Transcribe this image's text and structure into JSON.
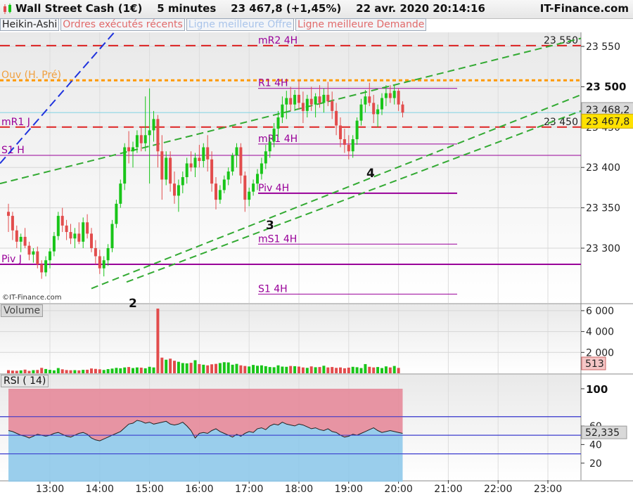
{
  "header": {
    "instrument": "Wall Street Cash (1€)",
    "interval": "5 minutes",
    "last": "23 467,8",
    "change": "(+1,45%)",
    "datetime": "22 avr. 2020 20:14:16",
    "site": "IT-Finance.com"
  },
  "tabs": [
    "Heikin-Ashi",
    "Ordres exécutés récents",
    "Ligne meilleure Offre",
    "Ligne meilleure Demande"
  ],
  "watermark": "©IT-Finance.com",
  "colors": {
    "up": "#19c519",
    "down": "#e24c4c",
    "rsi_upper_fill": "#e58a9a",
    "rsi_lower_fill": "#8fc9ea",
    "level": "#990099",
    "resistance": "#dd2222",
    "open_line": "#ff9900",
    "trend": "#33aa33",
    "trend_blue": "#1f33dd"
  },
  "chart_data": [
    {
      "type": "candlestick",
      "title": "Wall Street Cash (1€) — 5 minutes",
      "x_ticks": [
        "13:00",
        "14:00",
        "15:00",
        "16:00",
        "17:00",
        "18:00",
        "19:00",
        "20:00",
        "21:00",
        "22:00",
        "23:00"
      ],
      "y_ticks": [
        "23 300",
        "23 350",
        "23 400",
        "23 450",
        "23 500",
        "23 550"
      ],
      "ylim": [
        23260,
        23570
      ],
      "price_labels": {
        "last_ask": "23 468,2",
        "last_bid": "23 467,8"
      },
      "horizontal_levels": [
        {
          "name": "mR2 4H",
          "value": 23551,
          "text": "23 550",
          "style": "dash-red"
        },
        {
          "name": "Ouv (H. Pré)",
          "value": 23508,
          "style": "dash-orange"
        },
        {
          "name": "23 500",
          "value": 23500,
          "style": "axis-bold"
        },
        {
          "name": "R1 4H",
          "value": 23498
        },
        {
          "name": "mR1 J",
          "value": 23450,
          "text": "23 450",
          "style": "dash-red"
        },
        {
          "name": "mR1 4H",
          "value": 23429
        },
        {
          "name": "S1 H",
          "value": 23415
        },
        {
          "name": "Piv 4H",
          "value": 23368
        },
        {
          "name": "mS1 4H",
          "value": 23305
        },
        {
          "name": "Piv J",
          "value": 23280
        },
        {
          "name": "S1 4H",
          "value": 23243
        }
      ],
      "annotations": [
        "2",
        "3",
        "4"
      ],
      "candles": [
        {
          "t": "12:10",
          "o": 23345,
          "h": 23355,
          "l": 23320,
          "c": 23340
        },
        {
          "t": "12:15",
          "o": 23340,
          "h": 23345,
          "l": 23310,
          "c": 23322
        },
        {
          "t": "12:20",
          "o": 23322,
          "h": 23328,
          "l": 23300,
          "c": 23308
        },
        {
          "t": "12:25",
          "o": 23308,
          "h": 23318,
          "l": 23295,
          "c": 23314
        },
        {
          "t": "12:30",
          "o": 23314,
          "h": 23325,
          "l": 23300,
          "c": 23303
        },
        {
          "t": "12:35",
          "o": 23303,
          "h": 23308,
          "l": 23285,
          "c": 23292
        },
        {
          "t": "12:40",
          "o": 23292,
          "h": 23300,
          "l": 23282,
          "c": 23296
        },
        {
          "t": "12:45",
          "o": 23296,
          "h": 23302,
          "l": 23275,
          "c": 23280
        },
        {
          "t": "12:50",
          "o": 23280,
          "h": 23285,
          "l": 23262,
          "c": 23270
        },
        {
          "t": "12:55",
          "o": 23270,
          "h": 23290,
          "l": 23265,
          "c": 23285
        },
        {
          "t": "13:00",
          "o": 23285,
          "h": 23300,
          "l": 23275,
          "c": 23296
        },
        {
          "t": "13:05",
          "o": 23296,
          "h": 23320,
          "l": 23290,
          "c": 23315
        },
        {
          "t": "13:10",
          "o": 23315,
          "h": 23345,
          "l": 23310,
          "c": 23340
        },
        {
          "t": "13:15",
          "o": 23340,
          "h": 23350,
          "l": 23320,
          "c": 23328
        },
        {
          "t": "13:20",
          "o": 23328,
          "h": 23335,
          "l": 23310,
          "c": 23320
        },
        {
          "t": "13:25",
          "o": 23320,
          "h": 23330,
          "l": 23305,
          "c": 23312
        },
        {
          "t": "13:30",
          "o": 23312,
          "h": 23325,
          "l": 23300,
          "c": 23318
        },
        {
          "t": "13:35",
          "o": 23318,
          "h": 23332,
          "l": 23305,
          "c": 23308
        },
        {
          "t": "13:40",
          "o": 23308,
          "h": 23338,
          "l": 23300,
          "c": 23332
        },
        {
          "t": "13:45",
          "o": 23332,
          "h": 23342,
          "l": 23312,
          "c": 23318
        },
        {
          "t": "13:50",
          "o": 23318,
          "h": 23325,
          "l": 23295,
          "c": 23300
        },
        {
          "t": "13:55",
          "o": 23300,
          "h": 23310,
          "l": 23280,
          "c": 23290
        },
        {
          "t": "14:00",
          "o": 23290,
          "h": 23298,
          "l": 23268,
          "c": 23275
        },
        {
          "t": "14:05",
          "o": 23275,
          "h": 23290,
          "l": 23265,
          "c": 23285
        },
        {
          "t": "14:10",
          "o": 23285,
          "h": 23305,
          "l": 23278,
          "c": 23300
        },
        {
          "t": "14:15",
          "o": 23300,
          "h": 23335,
          "l": 23295,
          "c": 23330
        },
        {
          "t": "14:20",
          "o": 23330,
          "h": 23360,
          "l": 23325,
          "c": 23355
        },
        {
          "t": "14:25",
          "o": 23355,
          "h": 23385,
          "l": 23350,
          "c": 23380
        },
        {
          "t": "14:30",
          "o": 23380,
          "h": 23430,
          "l": 23372,
          "c": 23425
        },
        {
          "t": "14:35",
          "o": 23425,
          "h": 23445,
          "l": 23405,
          "c": 23420
        },
        {
          "t": "14:40",
          "o": 23420,
          "h": 23432,
          "l": 23400,
          "c": 23425
        },
        {
          "t": "14:45",
          "o": 23425,
          "h": 23446,
          "l": 23418,
          "c": 23440
        },
        {
          "t": "14:50",
          "o": 23440,
          "h": 23450,
          "l": 23420,
          "c": 23430
        },
        {
          "t": "14:55",
          "o": 23430,
          "h": 23488,
          "l": 23420,
          "c": 23440
        },
        {
          "t": "15:00",
          "o": 23440,
          "h": 23498,
          "l": 23380,
          "c": 23446
        },
        {
          "t": "15:05",
          "o": 23446,
          "h": 23470,
          "l": 23432,
          "c": 23460
        },
        {
          "t": "15:10",
          "o": 23460,
          "h": 23465,
          "l": 23400,
          "c": 23420
        },
        {
          "t": "15:15",
          "o": 23420,
          "h": 23440,
          "l": 23360,
          "c": 23385
        },
        {
          "t": "15:20",
          "o": 23385,
          "h": 23420,
          "l": 23378,
          "c": 23412
        },
        {
          "t": "15:25",
          "o": 23412,
          "h": 23420,
          "l": 23370,
          "c": 23380
        },
        {
          "t": "15:30",
          "o": 23380,
          "h": 23395,
          "l": 23355,
          "c": 23365
        },
        {
          "t": "15:35",
          "o": 23365,
          "h": 23385,
          "l": 23345,
          "c": 23378
        },
        {
          "t": "15:40",
          "o": 23378,
          "h": 23395,
          "l": 23368,
          "c": 23388
        },
        {
          "t": "15:45",
          "o": 23388,
          "h": 23412,
          "l": 23380,
          "c": 23405
        },
        {
          "t": "15:50",
          "o": 23405,
          "h": 23420,
          "l": 23395,
          "c": 23400
        },
        {
          "t": "15:55",
          "o": 23400,
          "h": 23418,
          "l": 23388,
          "c": 23412
        },
        {
          "t": "16:00",
          "o": 23412,
          "h": 23428,
          "l": 23400,
          "c": 23408
        },
        {
          "t": "16:05",
          "o": 23408,
          "h": 23430,
          "l": 23400,
          "c": 23425
        },
        {
          "t": "16:10",
          "o": 23425,
          "h": 23440,
          "l": 23395,
          "c": 23410
        },
        {
          "t": "16:15",
          "o": 23410,
          "h": 23420,
          "l": 23370,
          "c": 23380
        },
        {
          "t": "16:20",
          "o": 23380,
          "h": 23388,
          "l": 23348,
          "c": 23360
        },
        {
          "t": "16:25",
          "o": 23360,
          "h": 23378,
          "l": 23355,
          "c": 23372
        },
        {
          "t": "16:30",
          "o": 23372,
          "h": 23390,
          "l": 23368,
          "c": 23385
        },
        {
          "t": "16:35",
          "o": 23385,
          "h": 23400,
          "l": 23378,
          "c": 23395
        },
        {
          "t": "16:40",
          "o": 23395,
          "h": 23418,
          "l": 23390,
          "c": 23415
        },
        {
          "t": "16:45",
          "o": 23415,
          "h": 23430,
          "l": 23400,
          "c": 23425
        },
        {
          "t": "16:50",
          "o": 23425,
          "h": 23430,
          "l": 23380,
          "c": 23390
        },
        {
          "t": "16:55",
          "o": 23390,
          "h": 23395,
          "l": 23345,
          "c": 23360
        },
        {
          "t": "17:00",
          "o": 23360,
          "h": 23375,
          "l": 23352,
          "c": 23370
        },
        {
          "t": "17:05",
          "o": 23370,
          "h": 23385,
          "l": 23365,
          "c": 23380
        },
        {
          "t": "17:10",
          "o": 23380,
          "h": 23398,
          "l": 23372,
          "c": 23392
        },
        {
          "t": "17:15",
          "o": 23392,
          "h": 23412,
          "l": 23385,
          "c": 23405
        },
        {
          "t": "17:20",
          "o": 23405,
          "h": 23428,
          "l": 23398,
          "c": 23420
        },
        {
          "t": "17:25",
          "o": 23420,
          "h": 23438,
          "l": 23412,
          "c": 23432
        },
        {
          "t": "17:30",
          "o": 23432,
          "h": 23455,
          "l": 23425,
          "c": 23448
        },
        {
          "t": "17:35",
          "o": 23448,
          "h": 23470,
          "l": 23438,
          "c": 23462
        },
        {
          "t": "17:40",
          "o": 23462,
          "h": 23488,
          "l": 23455,
          "c": 23478
        },
        {
          "t": "17:45",
          "o": 23478,
          "h": 23495,
          "l": 23460,
          "c": 23486
        },
        {
          "t": "17:50",
          "o": 23486,
          "h": 23500,
          "l": 23470,
          "c": 23478
        },
        {
          "t": "17:55",
          "o": 23478,
          "h": 23496,
          "l": 23470,
          "c": 23490
        },
        {
          "t": "18:00",
          "o": 23490,
          "h": 23508,
          "l": 23472,
          "c": 23480
        },
        {
          "t": "18:05",
          "o": 23480,
          "h": 23494,
          "l": 23455,
          "c": 23470
        },
        {
          "t": "18:10",
          "o": 23470,
          "h": 23490,
          "l": 23462,
          "c": 23485
        },
        {
          "t": "18:15",
          "o": 23485,
          "h": 23500,
          "l": 23470,
          "c": 23478
        },
        {
          "t": "18:20",
          "o": 23478,
          "h": 23492,
          "l": 23462,
          "c": 23488
        },
        {
          "t": "18:25",
          "o": 23488,
          "h": 23502,
          "l": 23474,
          "c": 23480
        },
        {
          "t": "18:30",
          "o": 23480,
          "h": 23498,
          "l": 23468,
          "c": 23490
        },
        {
          "t": "18:35",
          "o": 23490,
          "h": 23506,
          "l": 23476,
          "c": 23482
        },
        {
          "t": "18:40",
          "o": 23482,
          "h": 23494,
          "l": 23460,
          "c": 23470
        },
        {
          "t": "18:45",
          "o": 23470,
          "h": 23480,
          "l": 23440,
          "c": 23452
        },
        {
          "t": "18:50",
          "o": 23452,
          "h": 23462,
          "l": 23425,
          "c": 23435
        },
        {
          "t": "18:55",
          "o": 23435,
          "h": 23448,
          "l": 23418,
          "c": 23428
        },
        {
          "t": "19:00",
          "o": 23428,
          "h": 23440,
          "l": 23410,
          "c": 23420
        },
        {
          "t": "19:05",
          "o": 23420,
          "h": 23440,
          "l": 23412,
          "c": 23435
        },
        {
          "t": "19:10",
          "o": 23435,
          "h": 23462,
          "l": 23428,
          "c": 23458
        },
        {
          "t": "19:15",
          "o": 23458,
          "h": 23485,
          "l": 23452,
          "c": 23478
        },
        {
          "t": "19:20",
          "o": 23478,
          "h": 23496,
          "l": 23468,
          "c": 23488
        },
        {
          "t": "19:25",
          "o": 23488,
          "h": 23505,
          "l": 23476,
          "c": 23480
        },
        {
          "t": "19:30",
          "o": 23480,
          "h": 23490,
          "l": 23455,
          "c": 23466
        },
        {
          "t": "19:35",
          "o": 23466,
          "h": 23478,
          "l": 23450,
          "c": 23472
        },
        {
          "t": "19:40",
          "o": 23472,
          "h": 23492,
          "l": 23465,
          "c": 23486
        },
        {
          "t": "19:45",
          "o": 23486,
          "h": 23502,
          "l": 23476,
          "c": 23492
        },
        {
          "t": "19:50",
          "o": 23492,
          "h": 23502,
          "l": 23480,
          "c": 23486
        },
        {
          "t": "19:55",
          "o": 23486,
          "h": 23502,
          "l": 23478,
          "c": 23495
        },
        {
          "t": "20:00",
          "o": 23495,
          "h": 23498,
          "l": 23470,
          "c": 23478
        },
        {
          "t": "20:05",
          "o": 23478,
          "h": 23482,
          "l": 23462,
          "c": 23468
        }
      ]
    },
    {
      "type": "bar",
      "title": "Volume",
      "y_ticks": [
        "2 000",
        "4 000",
        "6 000"
      ],
      "ylim": [
        0,
        6600
      ],
      "last_value": "513"
    },
    {
      "type": "line",
      "title": "RSI ( 14)",
      "y_ticks": [
        "20",
        "40",
        "60",
        "100"
      ],
      "ylim": [
        0,
        100
      ],
      "bands": [
        30,
        50,
        70
      ],
      "last_value": "52,335"
    }
  ]
}
